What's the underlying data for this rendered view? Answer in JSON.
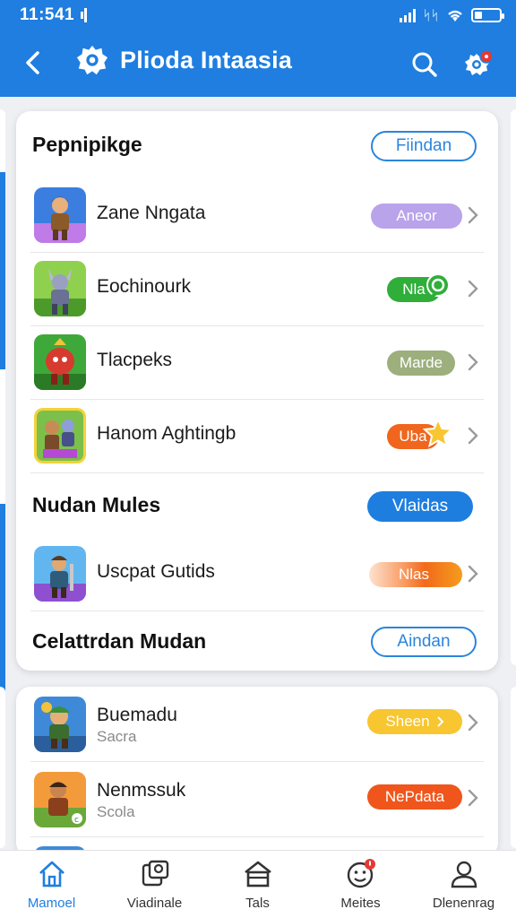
{
  "status_bar": {
    "time": "11:541",
    "network": "ᛋᛋ"
  },
  "app": {
    "title": "Plioda Intaasia"
  },
  "sections": [
    {
      "title": "Pepnipikge",
      "action": "Fiindan",
      "items": [
        {
          "name": "Zane Nngata",
          "badge": "Aneor",
          "badge_color": "#b9a3ea",
          "icon": "warrior-game-icon"
        },
        {
          "name": "Eochinourk",
          "badge": "Nla",
          "badge_color": "#2fae3a",
          "icon": "knight-game-icon"
        },
        {
          "name": "Tlacpeks",
          "badge": "Marde",
          "badge_color": "#9caf7d",
          "icon": "red-beast-game-icon"
        },
        {
          "name": "Hanom Aghtingb",
          "badge": "Uba",
          "badge_color": "#f0661c",
          "icon": "heroes-game-icon"
        }
      ]
    },
    {
      "title": "Nudan Mules",
      "action": "Vlaidas",
      "items": [
        {
          "name": "Uscpat Gutids",
          "badge": "Nlas",
          "badge_color": "#f26a1b",
          "icon": "adventurer-game-icon"
        }
      ]
    },
    {
      "title": "Celattrdan Mudan",
      "action": "Aindan",
      "items": []
    },
    {
      "title": "",
      "action": "",
      "items": [
        {
          "name": "Buemadu",
          "sub": "Sacra",
          "badge": "Sheen",
          "badge_color": "#f7c630",
          "icon": "dwarf-game-icon"
        },
        {
          "name": "Nenmssuk",
          "sub": "Scola",
          "badge": "NePdata",
          "badge_color": "#f0561c",
          "icon": "brawler-game-icon"
        }
      ]
    }
  ],
  "nav": [
    {
      "label": "Mamoel",
      "icon": "home-icon",
      "active": true
    },
    {
      "label": "Viadinale",
      "icon": "gallery-icon",
      "active": false
    },
    {
      "label": "Tals",
      "icon": "store-icon",
      "active": false
    },
    {
      "label": "Meites",
      "icon": "smiley-icon",
      "active": false
    },
    {
      "label": "Dlenenrag",
      "icon": "profile-icon",
      "active": false
    }
  ],
  "colors": {
    "primary": "#1f7ee0",
    "notification": "#e53935"
  }
}
